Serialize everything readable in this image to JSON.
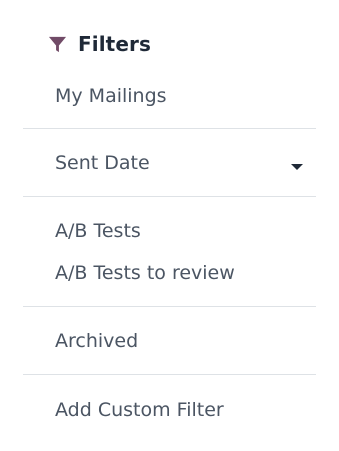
{
  "header": {
    "title": "Filters",
    "icon": "filter-icon",
    "accent_color": "#714b67"
  },
  "items": {
    "my_mailings": "My Mailings",
    "sent_date": "Sent Date",
    "ab_tests": "A/B Tests",
    "ab_tests_review": "A/B Tests to review",
    "archived": "Archived",
    "add_custom_filter": "Add Custom Filter"
  },
  "icons": {
    "sent_date_dropdown": "caret-down-icon"
  }
}
